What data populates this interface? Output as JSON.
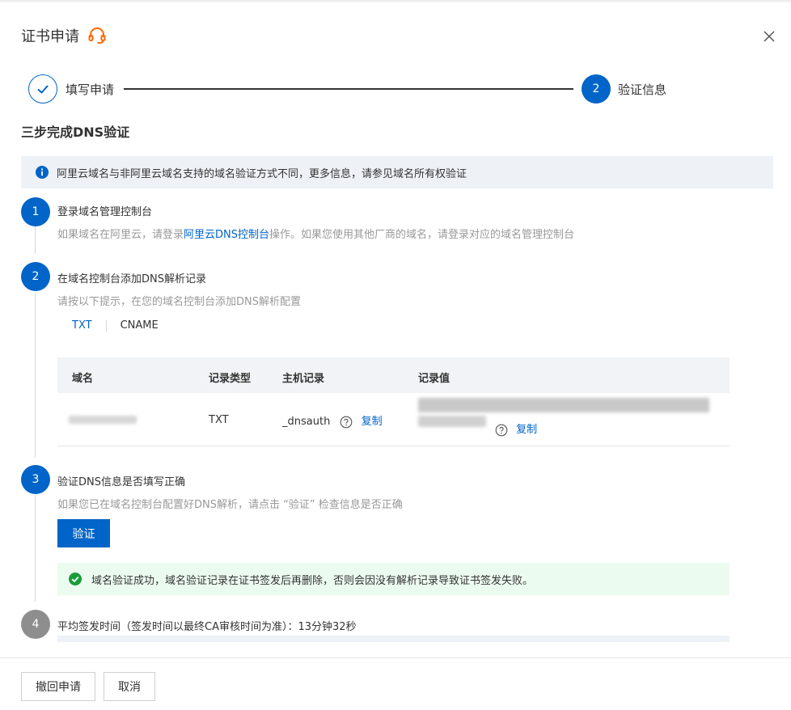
{
  "dialog": {
    "title": "证书申请",
    "close_icon": "close-icon",
    "support_icon": "headset-icon",
    "accent_color": "#0064c8"
  },
  "steps": [
    {
      "label": "填写申请",
      "state": "done"
    },
    {
      "label": "验证信息",
      "number": "2",
      "state": "current"
    }
  ],
  "section_title": "三步完成DNS验证",
  "info": {
    "text": "阿里云域名与非阿里云域名支持的域名验证方式不同，更多信息，请参见",
    "link": "域名所有权验证"
  },
  "items": [
    {
      "number": "1",
      "title": "登录域名管理控制台",
      "desc_pre": "如果域名在阿里云，请登录",
      "desc_link": "阿里云DNS控制台",
      "desc_post": "操作。如果您使用其他厂商的域名，请登录对应的域名管理控制台"
    },
    {
      "number": "2",
      "title": "在域名控制台添加DNS解析记录",
      "desc": "请按以下提示，在您的域名控制台添加DNS解析配置"
    },
    {
      "number": "3",
      "title": "验证DNS信息是否填写正确",
      "desc": "如果您已在域名控制台配置好DNS解析，请点击 “验证” 检查信息是否正确"
    },
    {
      "number": "4",
      "title": "平均签发时间（签发时间以最终CA审核时间为准）：13分钟32秒"
    }
  ],
  "tabs": [
    "TXT",
    "CNAME"
  ],
  "active_tab": "TXT",
  "table": {
    "headers": [
      "域名",
      "记录类型",
      "主机记录",
      "记录值"
    ],
    "row": {
      "record_type": "TXT",
      "host": "_dnsauth",
      "copy_label": "复制"
    }
  },
  "verify_button": "验证",
  "success_message": "域名验证成功，域名验证记录在证书签发后再删除，否则会因没有解析记录导致证书签发失败。",
  "footer": {
    "withdraw": "撤回申请",
    "cancel": "取消"
  }
}
